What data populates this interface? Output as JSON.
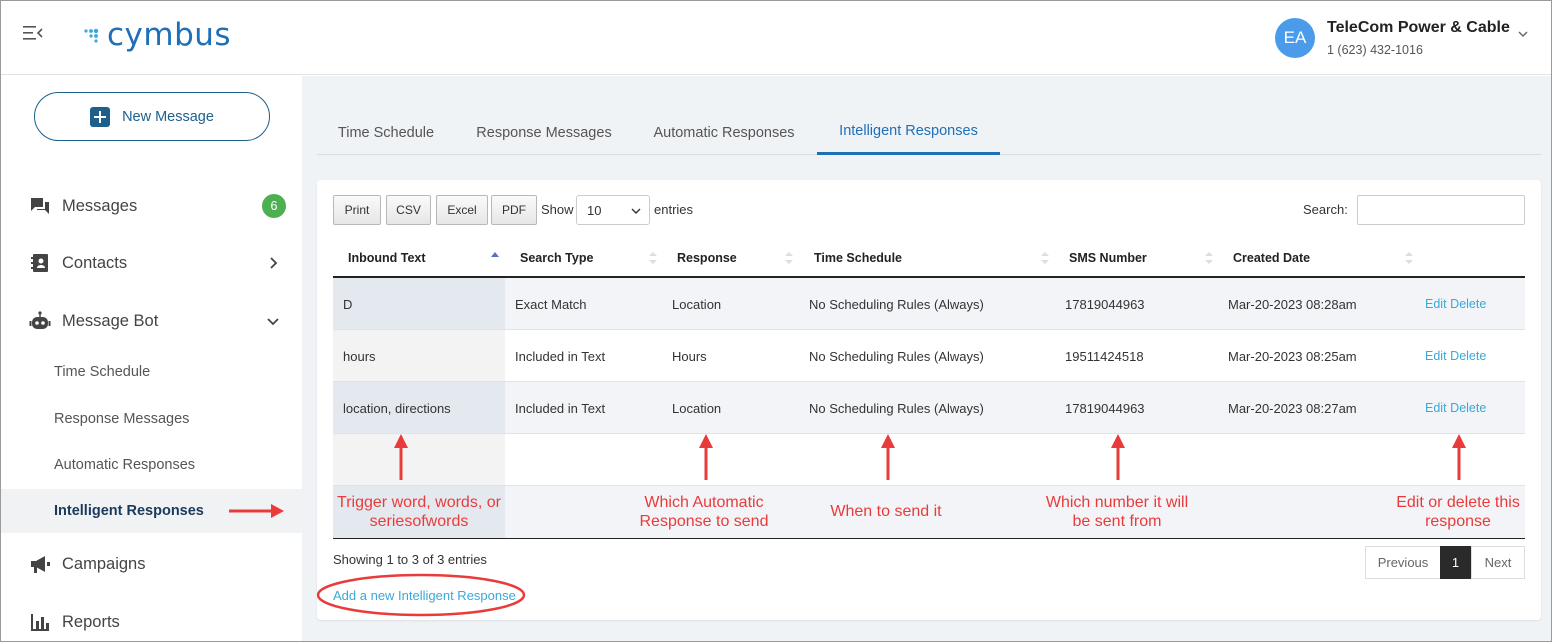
{
  "header": {
    "logo_text": "cymbus",
    "avatar_initials": "EA",
    "account_name": "TeleCom Power & Cable",
    "account_phone": "1 (623) 432-1016"
  },
  "sidebar": {
    "new_message": "New Message",
    "items": [
      {
        "label": "Messages",
        "badge": "6"
      },
      {
        "label": "Contacts"
      },
      {
        "label": "Message Bot"
      },
      {
        "label": "Campaigns"
      },
      {
        "label": "Reports"
      }
    ],
    "sub_items": [
      {
        "label": "Time Schedule"
      },
      {
        "label": "Response Messages"
      },
      {
        "label": "Automatic Responses"
      },
      {
        "label": "Intelligent Responses",
        "active": true
      }
    ]
  },
  "tabs": [
    {
      "label": "Time Schedule"
    },
    {
      "label": "Response Messages"
    },
    {
      "label": "Automatic Responses"
    },
    {
      "label": "Intelligent Responses",
      "active": true
    }
  ],
  "toolbar": {
    "print": "Print",
    "csv": "CSV",
    "excel": "Excel",
    "pdf": "PDF",
    "show_label": "Show",
    "entries_value": "10",
    "entries_label": "entries",
    "search_label": "Search:",
    "search_value": ""
  },
  "table": {
    "columns": [
      "Inbound Text",
      "Search Type",
      "Response",
      "Time Schedule",
      "SMS Number",
      "Created Date"
    ],
    "rows": [
      [
        "D",
        "Exact Match",
        "Location",
        "No Scheduling Rules (Always)",
        "17819044963",
        "Mar-20-2023 08:28am"
      ],
      [
        "hours",
        "Included in Text",
        "Hours",
        "No Scheduling Rules (Always)",
        "19511424518",
        "Mar-20-2023 08:25am"
      ],
      [
        "location, directions",
        "Included in Text",
        "Location",
        "No Scheduling Rules (Always)",
        "17819044963",
        "Mar-20-2023 08:27am"
      ]
    ],
    "edit_label": "Edit",
    "delete_label": "Delete"
  },
  "annotations": [
    "Trigger word, words, or seriesofwords",
    "Which Automatic Response to send",
    "When to send it",
    "Which number it will be sent from",
    "Edit or delete this response"
  ],
  "annotation_color": "#ea3b3b",
  "footer": {
    "info": "Showing 1 to 3 of 3 entries",
    "previous": "Previous",
    "page": "1",
    "next": "Next",
    "add_link": "Add a new Intelligent Response"
  },
  "colors": {
    "brand": "#1e6fb8",
    "link": "#3aa8d8",
    "badge": "#4caf50",
    "avatar": "#4a9bea"
  }
}
